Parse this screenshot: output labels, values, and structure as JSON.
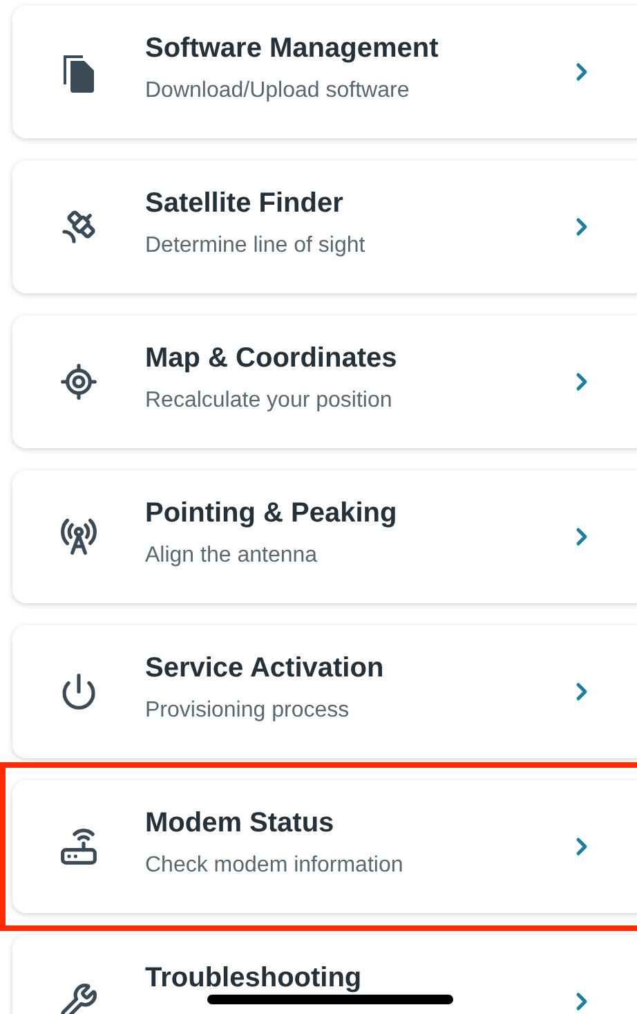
{
  "items": [
    {
      "kind": "files",
      "title": "Software Management",
      "subtitle": "Download/Upload software",
      "highlighted": false
    },
    {
      "kind": "satellite",
      "title": "Satellite Finder",
      "subtitle": "Determine line of sight",
      "highlighted": false
    },
    {
      "kind": "target",
      "title": "Map & Coordinates",
      "subtitle": "Recalculate your position",
      "highlighted": false
    },
    {
      "kind": "antenna",
      "title": "Pointing & Peaking",
      "subtitle": "Align the antenna",
      "highlighted": false
    },
    {
      "kind": "power",
      "title": "Service Activation",
      "subtitle": "Provisioning process",
      "highlighted": false
    },
    {
      "kind": "router",
      "title": "Modem Status",
      "subtitle": "Check modem information",
      "highlighted": true
    },
    {
      "kind": "wrench",
      "title": "Troubleshooting",
      "highlighted": false
    }
  ]
}
